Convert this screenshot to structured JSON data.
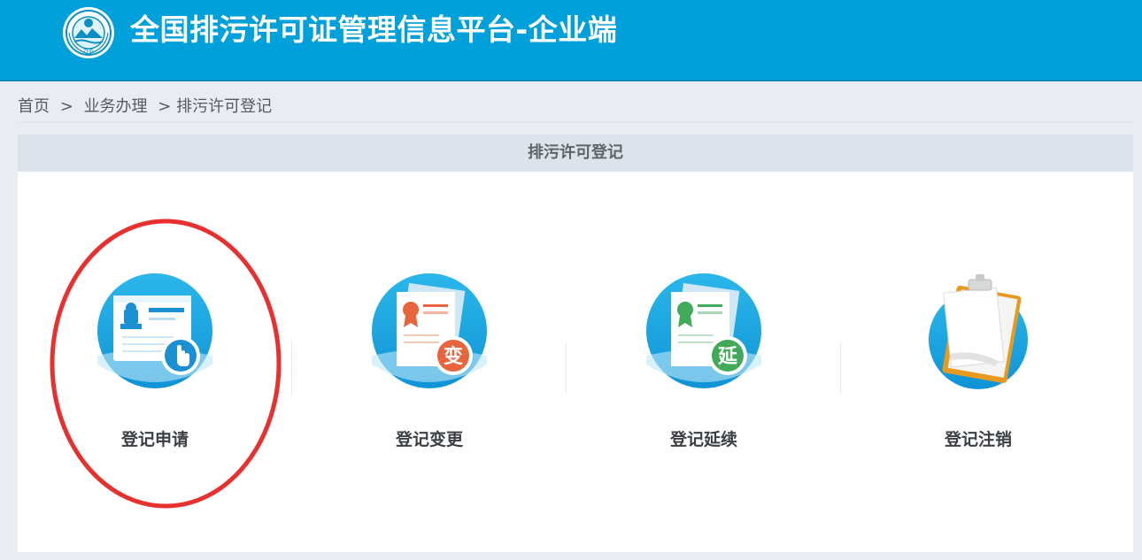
{
  "header": {
    "title": "全国排污许可证管理信息平台-企业端",
    "logo_icon": "environmental-protection-logo-icon",
    "background_color": "#00a0da"
  },
  "breadcrumb": {
    "items": [
      "首页",
      "业务办理",
      "排污许可登记"
    ],
    "separators": [
      ">",
      ">"
    ]
  },
  "panel": {
    "title": "排污许可登记"
  },
  "tiles": [
    {
      "label": "登记申请",
      "icon": "registration-card-hand-icon"
    },
    {
      "label": "登记变更",
      "icon": "certificate-change-icon",
      "badge": "变",
      "badge_color": "#e8643c"
    },
    {
      "label": "登记延续",
      "icon": "certificate-extend-icon",
      "badge": "延",
      "badge_color": "#41a95a"
    },
    {
      "label": "登记注销",
      "icon": "clipboard-cancel-icon"
    }
  ],
  "annotation": {
    "color": "#e8302f"
  }
}
